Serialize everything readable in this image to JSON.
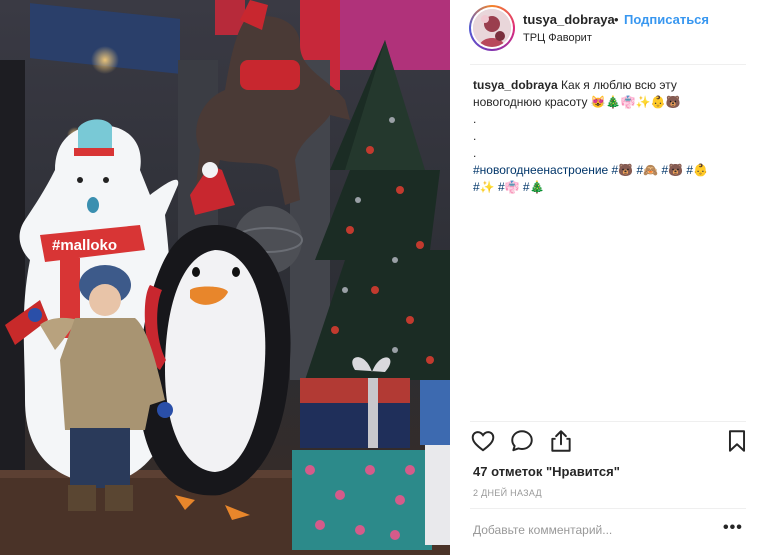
{
  "post": {
    "username": "tusya_dobraya",
    "separator": "•",
    "follow_label": "Подписаться",
    "location": "ТРЦ Фаворит",
    "caption": {
      "username": "tusya_dobraya",
      "text": "Как я люблю всю эту новогоднюю красоту 😻🎄👘✨👶🐻",
      "dot_lines": [
        ".",
        ".",
        "."
      ],
      "hashtags_line1": "#новогоднеенастроение #🐻 #🙈 #🐻 #👶",
      "hashtags_line2": "#✨ #👘 #🎄"
    },
    "likes_text": "47 отметок \"Нравится\"",
    "time_text": "2 дней назад",
    "comment_placeholder": "Добавьте комментарий...",
    "more_label": "•••"
  },
  "photo": {
    "sign_text": "#malloko"
  },
  "icons": {
    "heart": "heart-icon",
    "comment": "comment-icon",
    "share": "share-icon",
    "bookmark": "bookmark-icon"
  },
  "colors": {
    "link_blue": "#3897f0",
    "hashtag_blue": "#003569",
    "muted_gray": "#999999",
    "text": "#262626"
  }
}
